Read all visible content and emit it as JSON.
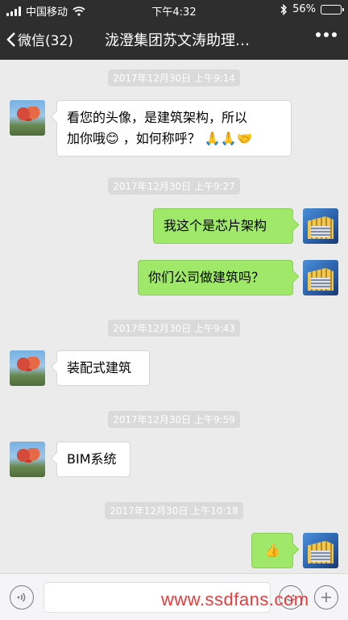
{
  "status_bar": {
    "carrier": "中国移动",
    "time": "下午4:32",
    "battery": "56%",
    "battery_level": 0.56,
    "icons": [
      "signal-icon",
      "wifi-icon",
      "bluetooth-icon",
      "battery-icon"
    ]
  },
  "nav": {
    "back_label": "微信(32)",
    "title": "泷澄集团苏文涛助理…",
    "more_icon": "more-icon"
  },
  "messages": [
    {
      "type": "timestamp",
      "text": "2017年12月30日 上午9:14"
    },
    {
      "type": "in",
      "line1": "看您的头像，是建筑架构，所以",
      "line2": "加你哦😊 ，如何称呼？ 🙏🙏🤝"
    },
    {
      "type": "timestamp",
      "text": "2017年12月30日 上午9:27"
    },
    {
      "type": "out",
      "text": "我这个是芯片架构"
    },
    {
      "type": "out",
      "text": "你们公司做建筑吗？"
    },
    {
      "type": "timestamp",
      "text": "2017年12月30日 上午9:43"
    },
    {
      "type": "in",
      "text": "装配式建筑"
    },
    {
      "type": "timestamp",
      "text": "2017年12月30日 上午9:59"
    },
    {
      "type": "in",
      "text": "BIM系统"
    },
    {
      "type": "timestamp",
      "text": "2017年12月30日 上午10:18"
    },
    {
      "type": "out",
      "text": "👍"
    }
  ],
  "input_bar": {
    "voice_icon": "voice-icon",
    "emoji_icon": "emoji-icon",
    "add_icon": "add-icon"
  },
  "watermark": "www.ssdfans.com",
  "colors": {
    "nav_bg": "#2e2e2e",
    "chat_bg": "#ebebeb",
    "out_bubble": "#9fe86a",
    "watermark": "#e63b3b"
  }
}
